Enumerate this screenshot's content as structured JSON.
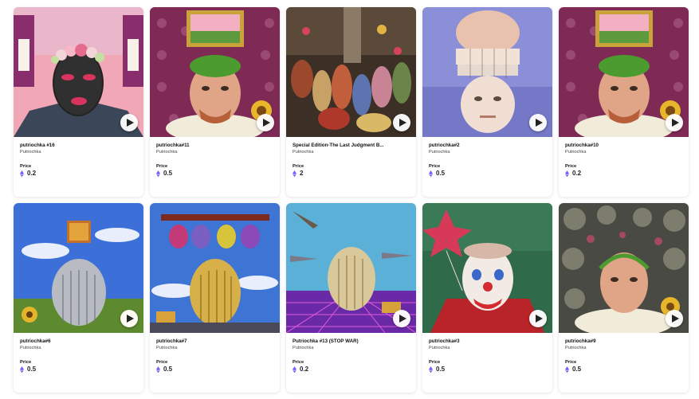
{
  "colors": {
    "eth": "#7b5cff",
    "card_bg": "#ffffff"
  },
  "price_label": "Price",
  "items": [
    {
      "title": "putriochka #16",
      "creator": "Putriochka",
      "price": "0.2",
      "icon": "eth-icon",
      "art": "masked-face-floral-crown"
    },
    {
      "title": "putriochka#11",
      "creator": "Putriochka",
      "price": "0.5",
      "icon": "eth-icon",
      "art": "green-hair-ruff-portrait"
    },
    {
      "title": "Special Edition-The Last Judgment B...",
      "creator": "Putriochka",
      "price": "2",
      "icon": "eth-icon",
      "art": "baroque-crowd-painting"
    },
    {
      "title": "putriochka#2",
      "creator": "Putriochka",
      "price": "0.5",
      "icon": "eth-icon",
      "art": "split-face-drip"
    },
    {
      "title": "putriochka#10",
      "creator": "Putriochka",
      "price": "0.2",
      "icon": "eth-icon",
      "art": "green-hair-ruff-portrait"
    },
    {
      "title": "putriochka#6",
      "creator": "Putriochka",
      "price": "0.5",
      "icon": "eth-icon",
      "art": "silver-head-sunflowers"
    },
    {
      "title": "putriochka#7",
      "creator": "Putriochka",
      "price": "0.5",
      "icon": "eth-icon",
      "art": "gold-head-skull-masks"
    },
    {
      "title": "Putriochka #13 (STOP WAR)",
      "creator": "Putriochka",
      "price": "0.2",
      "icon": "eth-icon",
      "art": "gold-head-jets-grid"
    },
    {
      "title": "putriochka#3",
      "creator": "Putriochka",
      "price": "0.5",
      "icon": "eth-icon",
      "art": "clown-balloon"
    },
    {
      "title": "putriochka#9",
      "creator": "Putriochka",
      "price": "0.5",
      "icon": "eth-icon",
      "art": "skulls-ruff-portrait"
    }
  ]
}
